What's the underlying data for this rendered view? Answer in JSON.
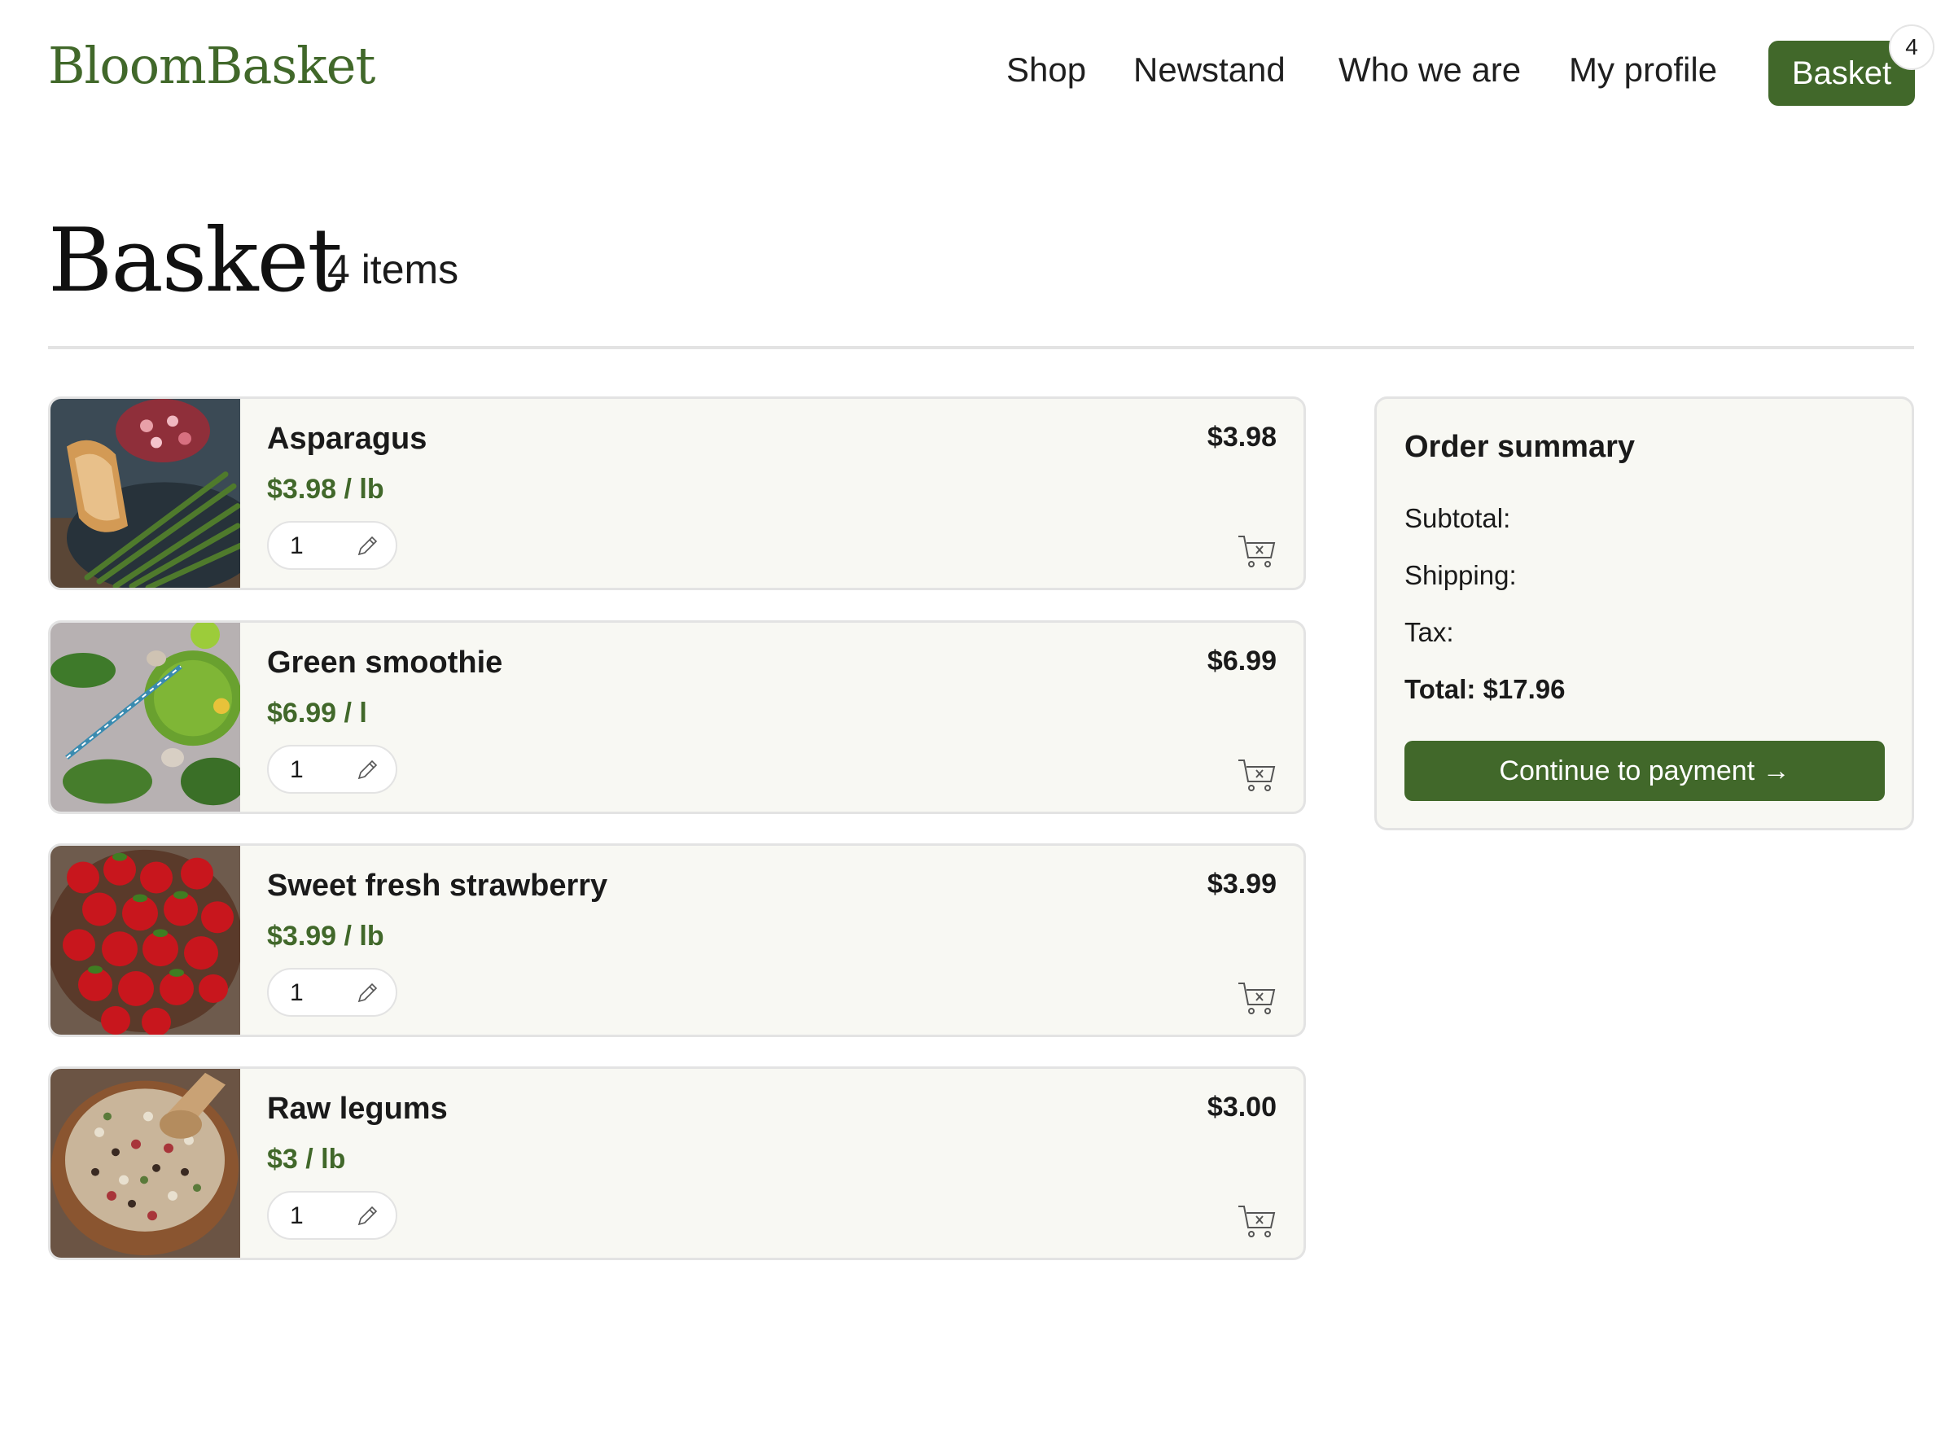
{
  "header": {
    "logo": "BloomBasket",
    "nav": {
      "shop": "Shop",
      "newstand": "Newstand",
      "who_we_are": "Who we are",
      "my_profile": "My profile",
      "basket": "Basket"
    },
    "basket_count": "4"
  },
  "page": {
    "title": "Basket",
    "item_count": "4 items"
  },
  "items": [
    {
      "name": "Asparagus",
      "unit_price": "$3.98 / lb",
      "total": "$3.98",
      "quantity": "1"
    },
    {
      "name": "Green smoothie",
      "unit_price": "$6.99 / l",
      "total": "$6.99",
      "quantity": "1"
    },
    {
      "name": "Sweet fresh strawberry",
      "unit_price": "$3.99 / lb",
      "total": "$3.99",
      "quantity": "1"
    },
    {
      "name": "Raw legums",
      "unit_price": "$3 / lb",
      "total": "$3.00",
      "quantity": "1"
    }
  ],
  "summary": {
    "title": "Order summary",
    "subtotal": "Subtotal:",
    "shipping": "Shipping:",
    "tax": "Tax:",
    "total": "Total: $17.96",
    "cta": "Continue to payment →"
  },
  "icons": {
    "edit": "pencil-icon",
    "remove": "cart-remove-icon"
  },
  "colors": {
    "brand": "#41682a",
    "card_bg": "#f8f8f3",
    "border": "#e3e3e3"
  }
}
